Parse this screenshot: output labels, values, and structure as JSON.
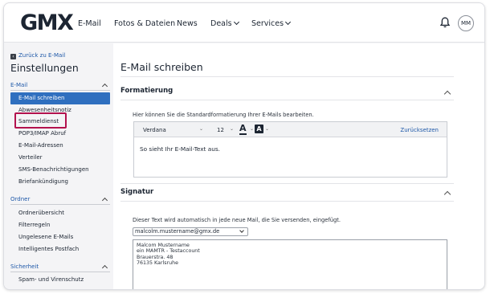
{
  "header": {
    "logo": "GMX",
    "nav": [
      {
        "label": "E-Mail",
        "dropdown": false
      },
      {
        "label": "Fotos & Dateien",
        "dropdown": false
      },
      {
        "label": "News",
        "dropdown": false
      },
      {
        "label": "Deals",
        "dropdown": true
      },
      {
        "label": "Services",
        "dropdown": true
      }
    ],
    "avatar_initials": "MM"
  },
  "sidebar": {
    "back_label": "Zurück zu E-Mail",
    "title": "Einstellungen",
    "sections": [
      {
        "label": "E-Mail",
        "items": [
          "E-Mail schreiben",
          "Abwesenheitsnotiz",
          "Sammeldienst",
          "POP3/IMAP Abruf",
          "E-Mail-Adressen",
          "Verteiler",
          "SMS-Benachrichtigungen",
          "Briefankündigung"
        ]
      },
      {
        "label": "Ordner",
        "items": [
          "Ordnerübersicht",
          "Filterregeln",
          "Ungelesene E-Mails",
          "Intelligentes Postfach"
        ]
      },
      {
        "label": "Sicherheit",
        "items": [
          "Spam- und Virenschutz"
        ]
      }
    ],
    "active_item": "E-Mail schreiben",
    "highlighted_item": "Sammeldienst"
  },
  "main": {
    "title": "E-Mail schreiben",
    "formatting": {
      "title": "Formatierung",
      "description": "Hier können Sie die Standardformatierung Ihrer E-Mails bearbeiten.",
      "font": "Verdana",
      "size": "12",
      "reset_label": "Zurücksetzen",
      "font_color_glyph": "A",
      "bg_color_glyph": "A",
      "preview_text": "So sieht Ihr E-Mail-Text aus."
    },
    "signature": {
      "title": "Signatur",
      "description": "Dieser Text wird automatisch in jede neue Mail, die Sie versenden, eingefügt.",
      "selected_address": "malcolm.mustername@gmx.de",
      "lines": [
        "Malcom Mustername",
        "ein MAMTR - Testaccount",
        "Brauerstra. 48",
        "76135 Karlsruhe"
      ]
    }
  },
  "colors": {
    "accent_blue": "#2f6fbf",
    "link_blue": "#1e58a8",
    "highlight": "#b3124e",
    "dark": "#1c2532"
  }
}
